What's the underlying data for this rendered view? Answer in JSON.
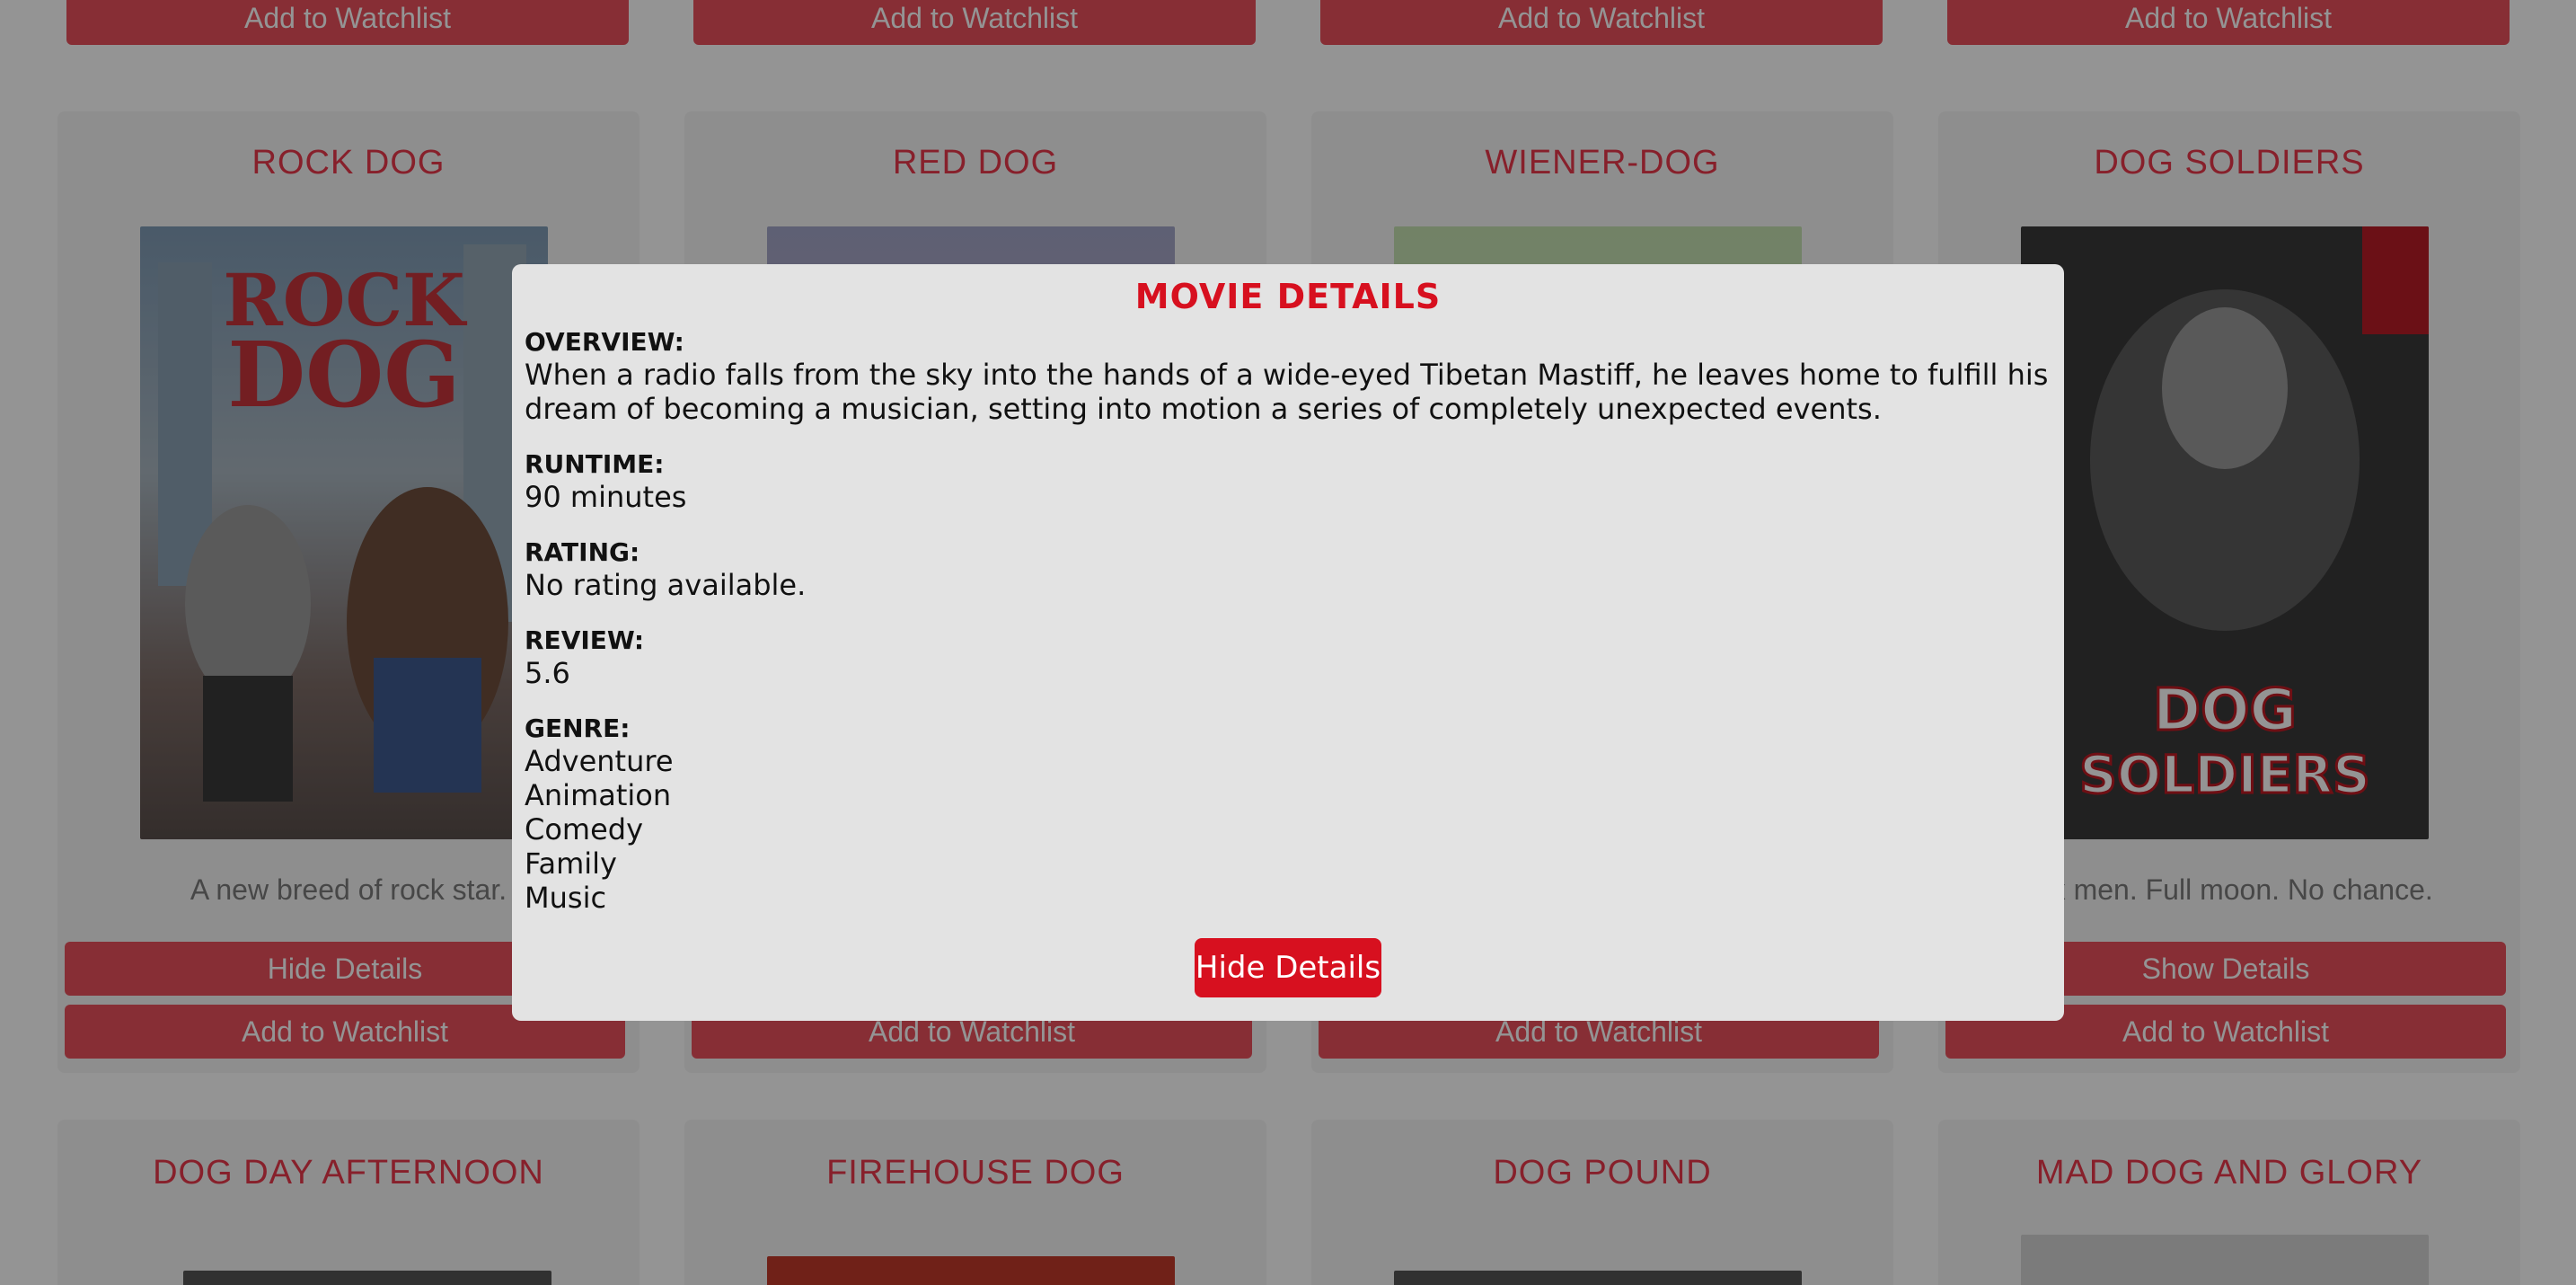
{
  "top_row_buttons": [
    "Add to Watchlist",
    "Add to Watchlist",
    "Add to Watchlist",
    "Add to Watchlist"
  ],
  "cards_row2": [
    {
      "title": "ROCK DOG",
      "tagline": "A new breed of rock star.",
      "show_btn": "Hide Details",
      "watch_btn": "Add to Watchlist"
    },
    {
      "title": "RED DOG",
      "tagline": "",
      "show_btn": "",
      "watch_btn": "Add to Watchlist"
    },
    {
      "title": "WIENER-DOG",
      "tagline": "",
      "show_btn": "",
      "watch_btn": "Add to Watchlist"
    },
    {
      "title": "DOG SOLDIERS",
      "tagline": "Six men. Full moon. No chance.",
      "show_btn": "Show Details",
      "watch_btn": "Add to Watchlist"
    }
  ],
  "cards_row3": [
    {
      "title": "DOG DAY AFTERNOON"
    },
    {
      "title": "FIREHOUSE DOG"
    },
    {
      "title": "DOG POUND"
    },
    {
      "title": "MAD DOG AND GLORY"
    }
  ],
  "modal": {
    "title": "MOVIE DETAILS",
    "overview_label": "OVERVIEW:",
    "overview": "When a radio falls from the sky into the hands of a wide-eyed Tibetan Mastiff, he leaves home to fulfill his dream of becoming a musician, setting into motion a series of completely unexpected events.",
    "runtime_label": "RUNTIME:",
    "runtime": "90 minutes",
    "rating_label": "RATING:",
    "rating": "No rating available.",
    "review_label": "REVIEW:",
    "review": "5.6",
    "genre_label": "GENRE:",
    "genres": [
      "Adventure",
      "Animation",
      "Comedy",
      "Family",
      "Music"
    ],
    "hide_button": "Hide Details"
  },
  "colors": {
    "accent": "#d7101f",
    "button": "#e8505c",
    "modal_bg": "#e3e3e3"
  }
}
